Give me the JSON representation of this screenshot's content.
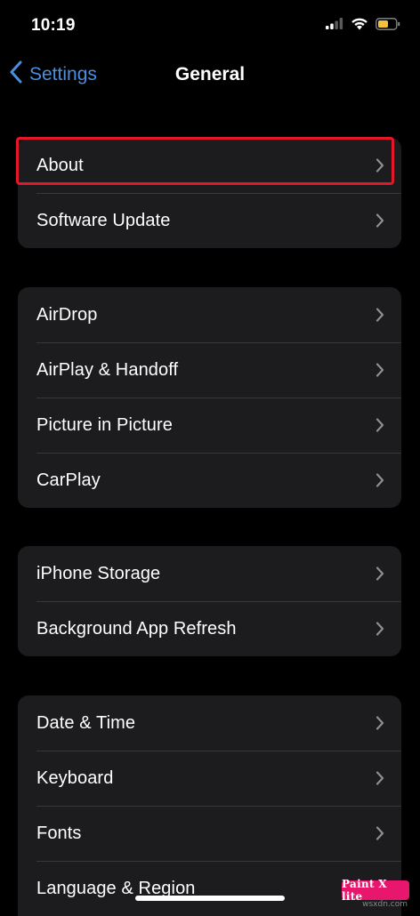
{
  "status_bar": {
    "time": "10:19",
    "icons": [
      "cellular-signal-icon",
      "wifi-icon",
      "battery-icon"
    ],
    "battery_color": "#f2c33a"
  },
  "nav": {
    "back_label": "Settings",
    "title": "General",
    "accent_color": "#4a8fe0"
  },
  "groups": [
    {
      "items": [
        "About",
        "Software Update"
      ]
    },
    {
      "items": [
        "AirDrop",
        "AirPlay & Handoff",
        "Picture in Picture",
        "CarPlay"
      ]
    },
    {
      "items": [
        "iPhone Storage",
        "Background App Refresh"
      ]
    },
    {
      "items": [
        "Date & Time",
        "Keyboard",
        "Fonts",
        "Language & Region"
      ]
    }
  ],
  "annotation": {
    "highlighted_item": "About",
    "color": "#e3162a"
  },
  "watermark": {
    "label": "Paint X lite",
    "sub": "wsxdn.com"
  }
}
